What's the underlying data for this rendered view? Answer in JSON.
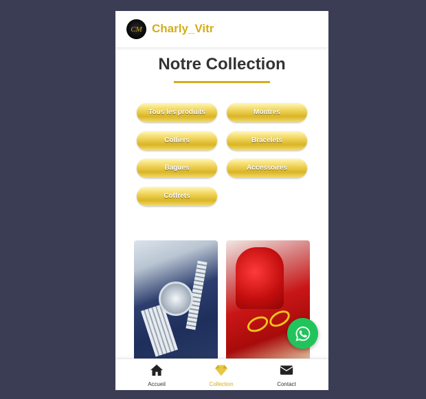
{
  "header": {
    "logo_text": "CM",
    "brand": "Charly_Vitr"
  },
  "page": {
    "title": "Notre Collection"
  },
  "filters": [
    {
      "label": "Tous les produits"
    },
    {
      "label": "Montres"
    },
    {
      "label": "Colliers"
    },
    {
      "label": "Bracelets"
    },
    {
      "label": "Bagues"
    },
    {
      "label": "Accessoires"
    },
    {
      "label": "Coffrets"
    }
  ],
  "products": [
    {
      "image": "watch-photo"
    },
    {
      "image": "ring-box-photo"
    }
  ],
  "whatsapp": {
    "icon": "whatsapp-icon",
    "color": "#21c45a"
  },
  "nav": {
    "items": [
      {
        "label": "Accueil",
        "icon": "home-icon"
      },
      {
        "label": "Collection",
        "icon": "diamond-icon",
        "active": true
      },
      {
        "label": "Contact",
        "icon": "envelope-icon"
      }
    ]
  },
  "colors": {
    "accent": "#d4ac1c",
    "background": "#3a3d54"
  }
}
